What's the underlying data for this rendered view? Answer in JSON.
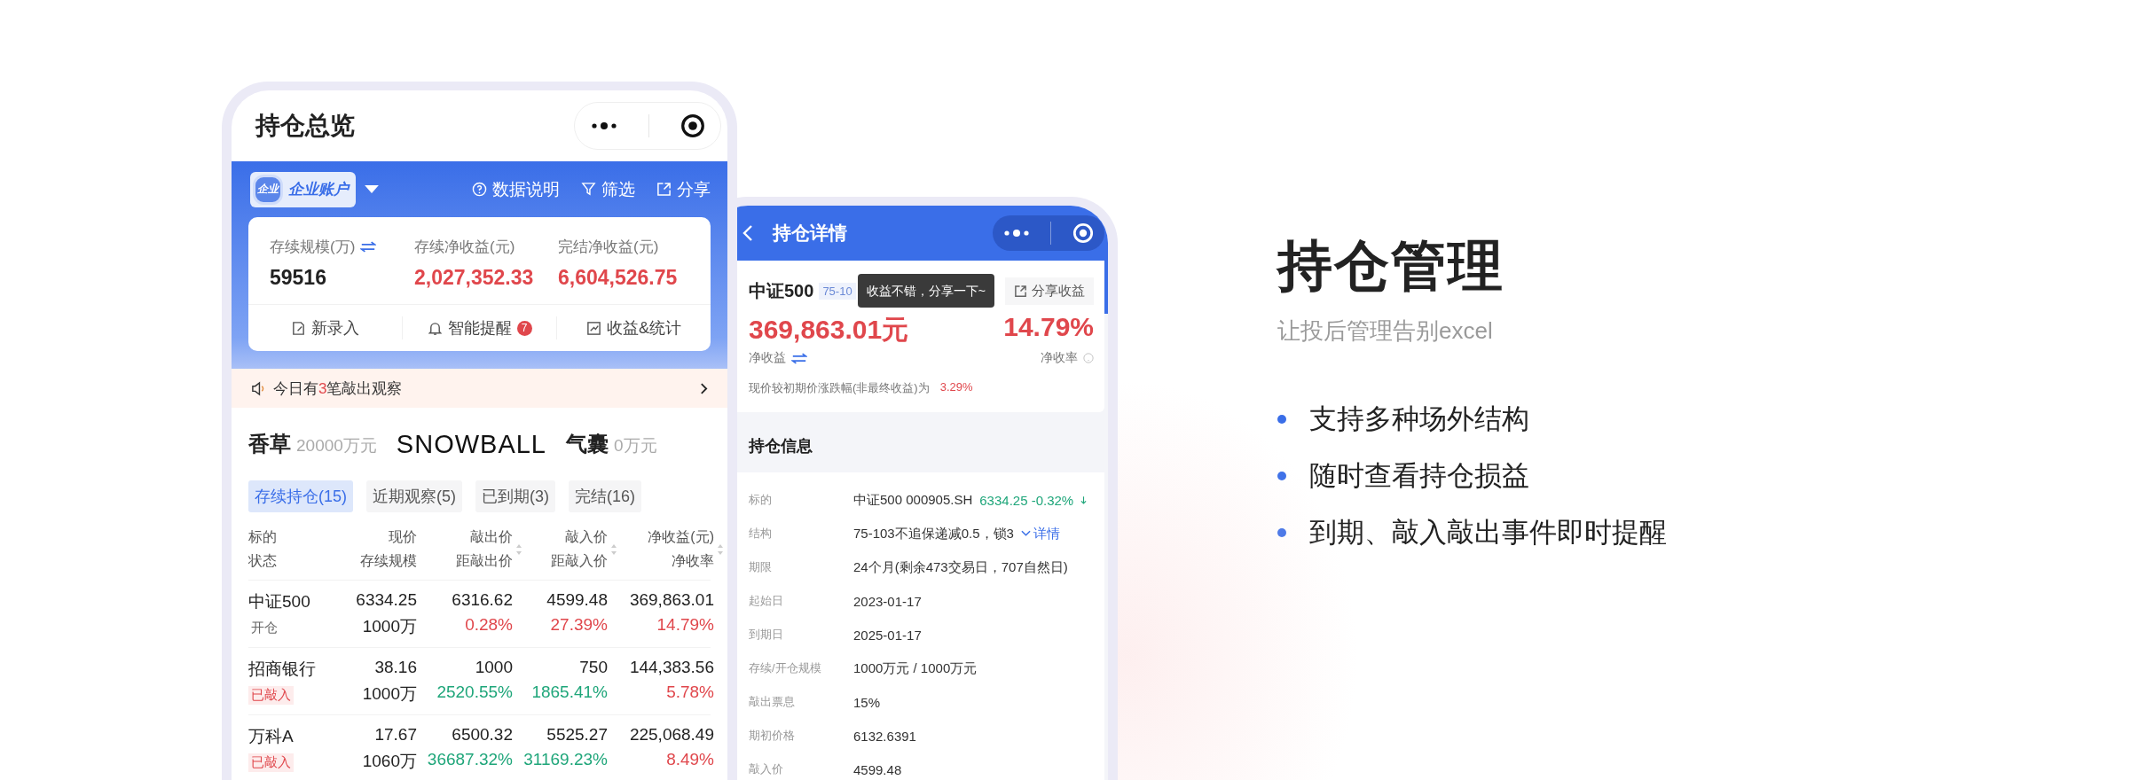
{
  "phone_overview": {
    "title": "持仓总览",
    "account": {
      "logo": "企业",
      "label": "企业账户"
    },
    "actions": [
      {
        "label": "数据说明"
      },
      {
        "label": "筛选"
      },
      {
        "label": "分享"
      }
    ],
    "summary": [
      {
        "label": "存续规模(万)",
        "value": "59516",
        "color": "#222222",
        "swap": true
      },
      {
        "label": "存续净收益(元)",
        "value": "2,027,352.33",
        "color": "#e0474c",
        "swap": false
      },
      {
        "label": "完结净收益(元)",
        "value": "6,604,526.75",
        "color": "#e0474c",
        "swap": false
      }
    ],
    "shortcuts": [
      {
        "label": "新录入"
      },
      {
        "label": "智能提醒",
        "badge": "7"
      },
      {
        "label": "收益&统计"
      }
    ],
    "notice": {
      "before": "今日有",
      "count": "3",
      "after": "笔敲出观察"
    },
    "brands": [
      {
        "kind": "cn",
        "name": "香草",
        "amount": "20000万元"
      },
      {
        "kind": "logo",
        "name": "SNOWBALL"
      },
      {
        "kind": "cn",
        "name": "气囊",
        "amount": "0万元"
      }
    ],
    "tabs": [
      {
        "label": "存续持仓(15)",
        "selected": true
      },
      {
        "label": "近期观察(5)",
        "selected": false
      },
      {
        "label": "已到期(3)",
        "selected": false
      },
      {
        "label": "完结(16)",
        "selected": false
      }
    ],
    "table": {
      "columns": [
        {
          "line1": "标的",
          "line2": "状态",
          "sortable": false
        },
        {
          "line1": "现价",
          "line2": "存续规模",
          "sortable": false
        },
        {
          "line1": "敲出价",
          "line2": "距敲出价",
          "sortable": true
        },
        {
          "line1": "敲入价",
          "line2": "距敲入价",
          "sortable": true
        },
        {
          "line1": "净收益(元)",
          "line2": "净收率",
          "sortable": true
        }
      ],
      "rows": [
        {
          "name": "中证500",
          "status": "开仓",
          "knocked_in": false,
          "price": "6334.25",
          "scale": "1000万",
          "ko": "6316.62",
          "ko_dist": "0.28%",
          "ki": "4599.48",
          "ki_dist": "27.39%",
          "pnl": "369,863.01",
          "rate": "14.79%"
        },
        {
          "name": "招商银行",
          "status": "已敲入",
          "knocked_in": true,
          "price": "38.16",
          "scale": "1000万",
          "ko": "1000",
          "ko_dist": "2520.55%",
          "ki": "750",
          "ki_dist": "1865.41%",
          "pnl": "144,383.56",
          "rate": "5.78%"
        },
        {
          "name": "万科A",
          "status": "已敲入",
          "knocked_in": true,
          "price": "17.67",
          "scale": "1060万",
          "ko": "6500.32",
          "ko_dist": "36687.32%",
          "ki": "5525.27",
          "ki_dist": "31169.23%",
          "pnl": "225,068.49",
          "rate": "8.49%"
        }
      ]
    }
  },
  "phone_detail": {
    "title": "持仓详情",
    "name": "中证500",
    "tag": "75-10",
    "tooltip": "收益不错，分享一下~",
    "share": "分享收益",
    "pnl": "369,863.01元",
    "pnl_label": "净收益",
    "rate": "14.79%",
    "rate_label": "净收率",
    "change_label": "现价较初期价涨跌幅(非最终收益)为",
    "change_value": "3.29%",
    "section": "持仓信息",
    "info": [
      {
        "kind": "quote",
        "label": "标的",
        "value": "中证500 000905.SH",
        "quote": "6334.25 -0.32%"
      },
      {
        "kind": "link",
        "label": "结构",
        "value": "75-103不追保递减0.5，锁3",
        "link": "详情"
      },
      {
        "kind": "plain",
        "label": "期限",
        "value": "24个月(剩余473交易日，707自然日)"
      },
      {
        "kind": "plain",
        "label": "起始日",
        "value": "2023-01-17"
      },
      {
        "kind": "plain",
        "label": "到期日",
        "value": "2025-01-17"
      },
      {
        "kind": "plain",
        "label": "存续/开仓规模",
        "value": "1000万元 / 1000万元"
      },
      {
        "kind": "plain",
        "label": "敲出票息",
        "value": "15%"
      },
      {
        "kind": "plain",
        "label": "期初价格",
        "value": "6132.6391"
      },
      {
        "kind": "plain",
        "label": "敲入价",
        "value": "4599.48"
      }
    ]
  },
  "feature": {
    "title": "持仓管理",
    "subtitle": "让投后管理告别excel",
    "bullets": [
      "支持多种场外结构",
      "随时查看持仓损益",
      "到期、敲入敲出事件即时提醒"
    ]
  }
}
